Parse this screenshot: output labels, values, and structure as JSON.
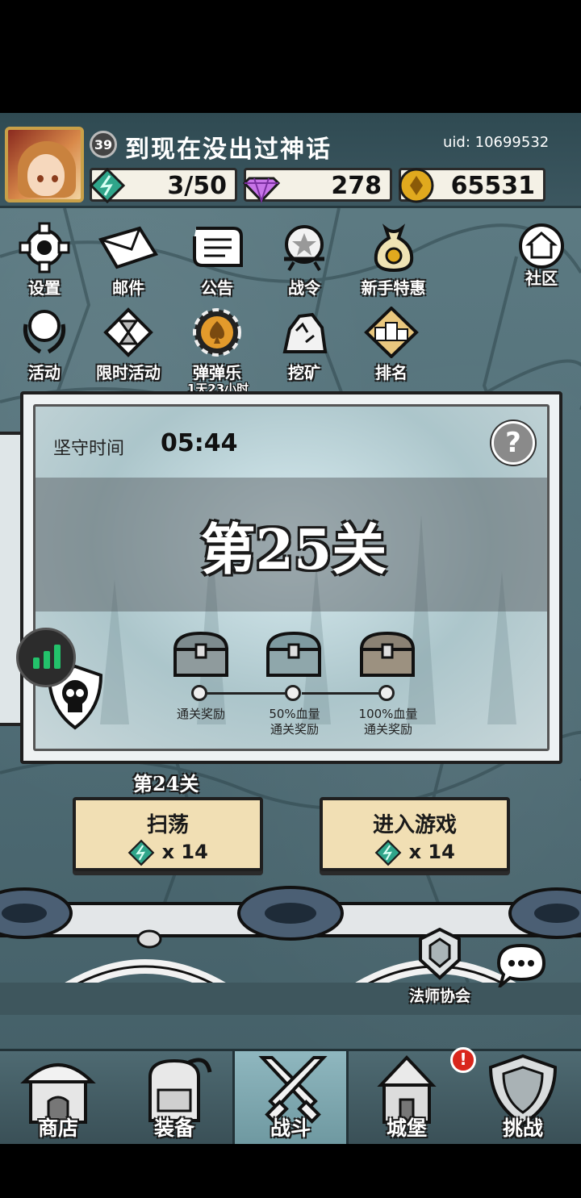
{
  "player": {
    "level": "39",
    "name": "到现在没出过神话",
    "uid": "uid: 10699532"
  },
  "resources": {
    "energy": "3/50",
    "gems": "278",
    "gold": "65531"
  },
  "menu": {
    "row1": [
      {
        "label": "设置",
        "icon": "gear-icon"
      },
      {
        "label": "邮件",
        "icon": "mail-icon"
      },
      {
        "label": "公告",
        "icon": "scroll-icon"
      },
      {
        "label": "战令",
        "icon": "battle-pass-icon"
      },
      {
        "label": "新手特惠",
        "icon": "money-bag-icon"
      },
      {
        "label": "社区",
        "icon": "home-icon"
      }
    ],
    "row2": [
      {
        "label": "活动",
        "icon": "laurel-icon"
      },
      {
        "label": "限时活动",
        "icon": "hourglass-icon"
      },
      {
        "label": "弹弹乐",
        "icon": "spade-chip-icon"
      },
      {
        "label": "挖矿",
        "icon": "ore-icon"
      },
      {
        "label": "排名",
        "icon": "podium-icon"
      }
    ],
    "timer": "1天23小时"
  },
  "stage": {
    "hold_label": "坚守时间",
    "hold_time": "05:44",
    "title": "第25关",
    "help": "?",
    "rewards": [
      {
        "label": "通关奖励"
      },
      {
        "label": "50%血量\n通关奖励"
      },
      {
        "label": "100%血量\n通关奖励"
      }
    ]
  },
  "previous_stage": "第24关",
  "actions": {
    "sweep": {
      "label": "扫荡",
      "cost": "x 14"
    },
    "enter": {
      "label": "进入游戏",
      "cost": "x 14"
    }
  },
  "guild": {
    "label": "法师协会"
  },
  "nav": [
    {
      "label": "商店",
      "icon": "shop-icon"
    },
    {
      "label": "装备",
      "icon": "backpack-icon"
    },
    {
      "label": "战斗",
      "icon": "crossed-swords-icon",
      "active": true
    },
    {
      "label": "城堡",
      "icon": "castle-icon"
    },
    {
      "label": "挑战",
      "icon": "shield-icon"
    }
  ],
  "alert": "!",
  "colors": {
    "energy": "#2fa58a",
    "gem": "#c774e8",
    "gold": "#e0a91e",
    "button": "#f1dfb4",
    "active_tab": "#8fb7bf",
    "alert": "#d9261c"
  }
}
